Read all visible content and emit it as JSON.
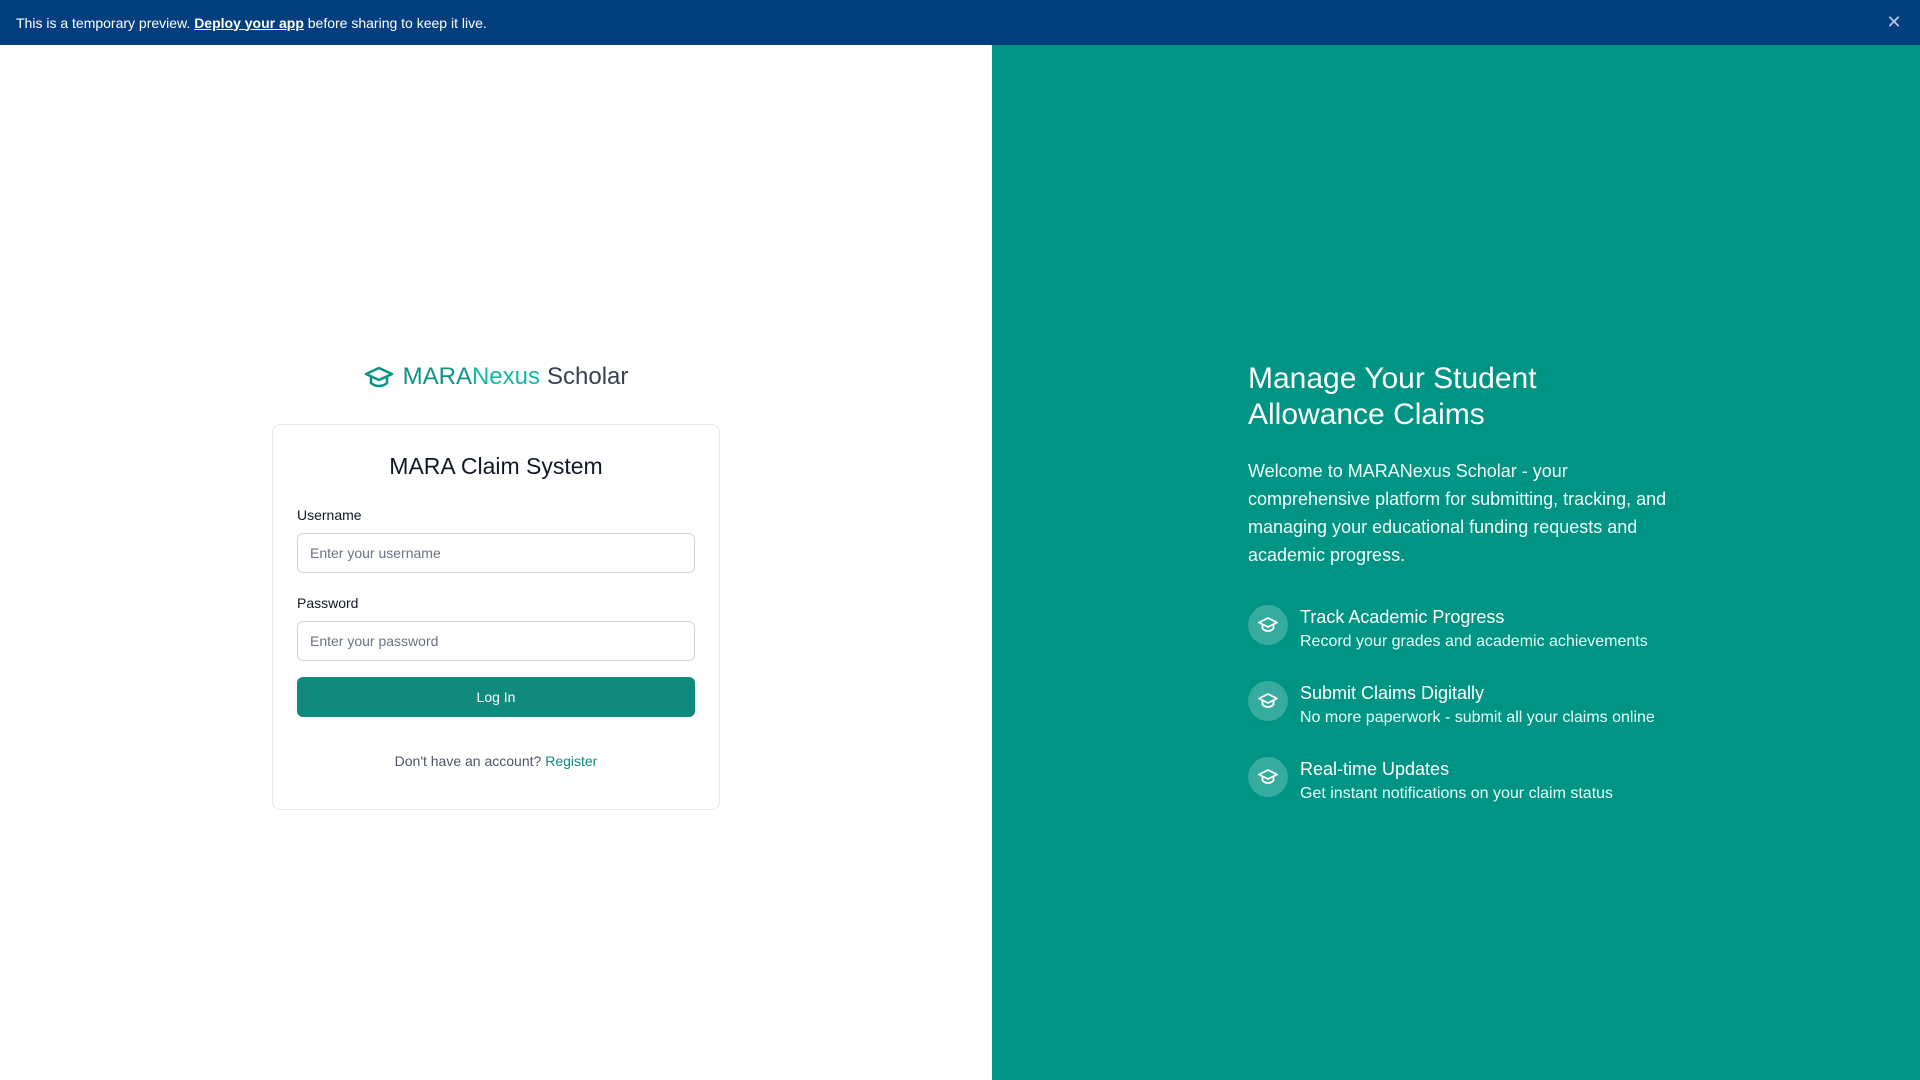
{
  "banner": {
    "text_before": "This is a temporary preview.",
    "link_text": "Deploy your app",
    "text_after": "before sharing to keep it live.",
    "close_icon": "close-icon"
  },
  "brand": {
    "icon": "graduation-cap-icon",
    "part1": "MARA",
    "part2": "Nexus",
    "part3": "Scholar"
  },
  "login": {
    "title": "MARA Claim System",
    "username_label": "Username",
    "username_placeholder": "Enter your username",
    "username_value": "",
    "password_label": "Password",
    "password_placeholder": "Enter your password",
    "password_value": "",
    "submit_label": "Log In",
    "register_prompt": "Don't have an account?",
    "register_link": "Register"
  },
  "promo": {
    "heading": "Manage Your Student Allowance Claims",
    "intro": "Welcome to MARANexus Scholar - your comprehensive platform for submitting, tracking, and managing your educational funding requests and academic progress.",
    "features": [
      {
        "icon": "graduation-cap-icon",
        "title": "Track Academic Progress",
        "description": "Record your grades and academic achievements"
      },
      {
        "icon": "graduation-cap-icon",
        "title": "Submit Claims Digitally",
        "description": "No more paperwork - submit all your claims online"
      },
      {
        "icon": "graduation-cap-icon",
        "title": "Real-time Updates",
        "description": "Get instant notifications on your claim status"
      }
    ]
  },
  "colors": {
    "banner_bg": "#033f7f",
    "accent": "#0f8a7d",
    "panel_bg": "#009484"
  }
}
